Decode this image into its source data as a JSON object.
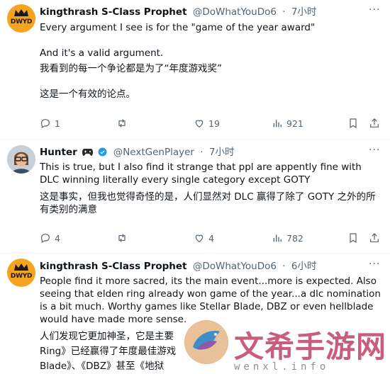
{
  "tweets": [
    {
      "name": "kingthrash S-Class Prophet",
      "handle": "@DoWhatYouDo6",
      "sep": "·",
      "time": "7小时",
      "avatar_text": "DWYD",
      "lines": [
        "Every argument I see is for the \"game of the year award\"",
        "And it's a valid argument.",
        "我看到的每一个争论都是为了“年度游戏奖”",
        "这是一个有效的论点。"
      ],
      "stats": {
        "replies": "1",
        "retweets": "",
        "likes": "19",
        "views": "921"
      }
    },
    {
      "name": "Hunter",
      "handle": "@NextGenPlayer",
      "sep": "·",
      "time": "7小时",
      "lines": [
        "This is true, but I also find it strange that ppl are appently fine with DLC winning literally every single category except GOTY",
        "这是事实，但我也觉得奇怪的是，人们显然对 DLC 赢得了除了 GOTY 之外的所有类别的满意"
      ],
      "stats": {
        "replies": "4",
        "retweets": "",
        "likes": "4",
        "views": "782"
      }
    },
    {
      "name": "kingthrash S-Class Prophet",
      "handle": "@DoWhatYouDo6",
      "sep": "·",
      "time": "6小时",
      "avatar_text": "DWYD",
      "lines": [
        "People find it more sacred, its the main event...more is expected. Also seeing that elden ring already won game of the year...a dlc nomination is a bit much. Worthy games like Stellar Blade, DBZ or even hellblade would have made more sense.",
        "人们发现它更加神圣，它是主要",
        "Ring》已经赢得了年度最佳游戏",
        "Blade》、《DBZ》甚至《地狱"
      ]
    }
  ],
  "watermark": {
    "text": "文希手游网",
    "url": "wenxl.info"
  },
  "colors": {
    "text": "#0f1419",
    "muted": "#536471",
    "verified": "#1d9bf0",
    "divider": "#eff3f4",
    "avatar": "#f6a31f"
  }
}
